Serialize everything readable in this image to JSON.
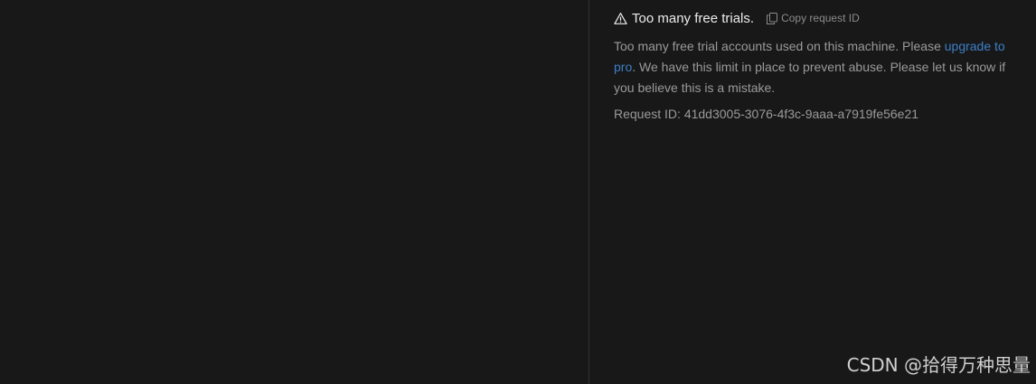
{
  "error": {
    "title": "Too many free trials.",
    "copy_label": "Copy request ID",
    "message_before": "Too many free trial accounts used on this machine. Please ",
    "link_text": "upgrade to pro",
    "message_after": ". We have this limit in place to prevent abuse. Please let us know if you believe this is a mistake.",
    "request_id": "Request ID: 41dd3005-3076-4f3c-9aaa-a7919fe56e21"
  },
  "watermark": "CSDN @拾得万种思量",
  "icons": {
    "warning": "warning-icon",
    "copy": "copy-icon"
  },
  "colors": {
    "background": "#181818",
    "title": "#ececec",
    "text": "#9a9a9a",
    "link": "#3c7fc8"
  }
}
